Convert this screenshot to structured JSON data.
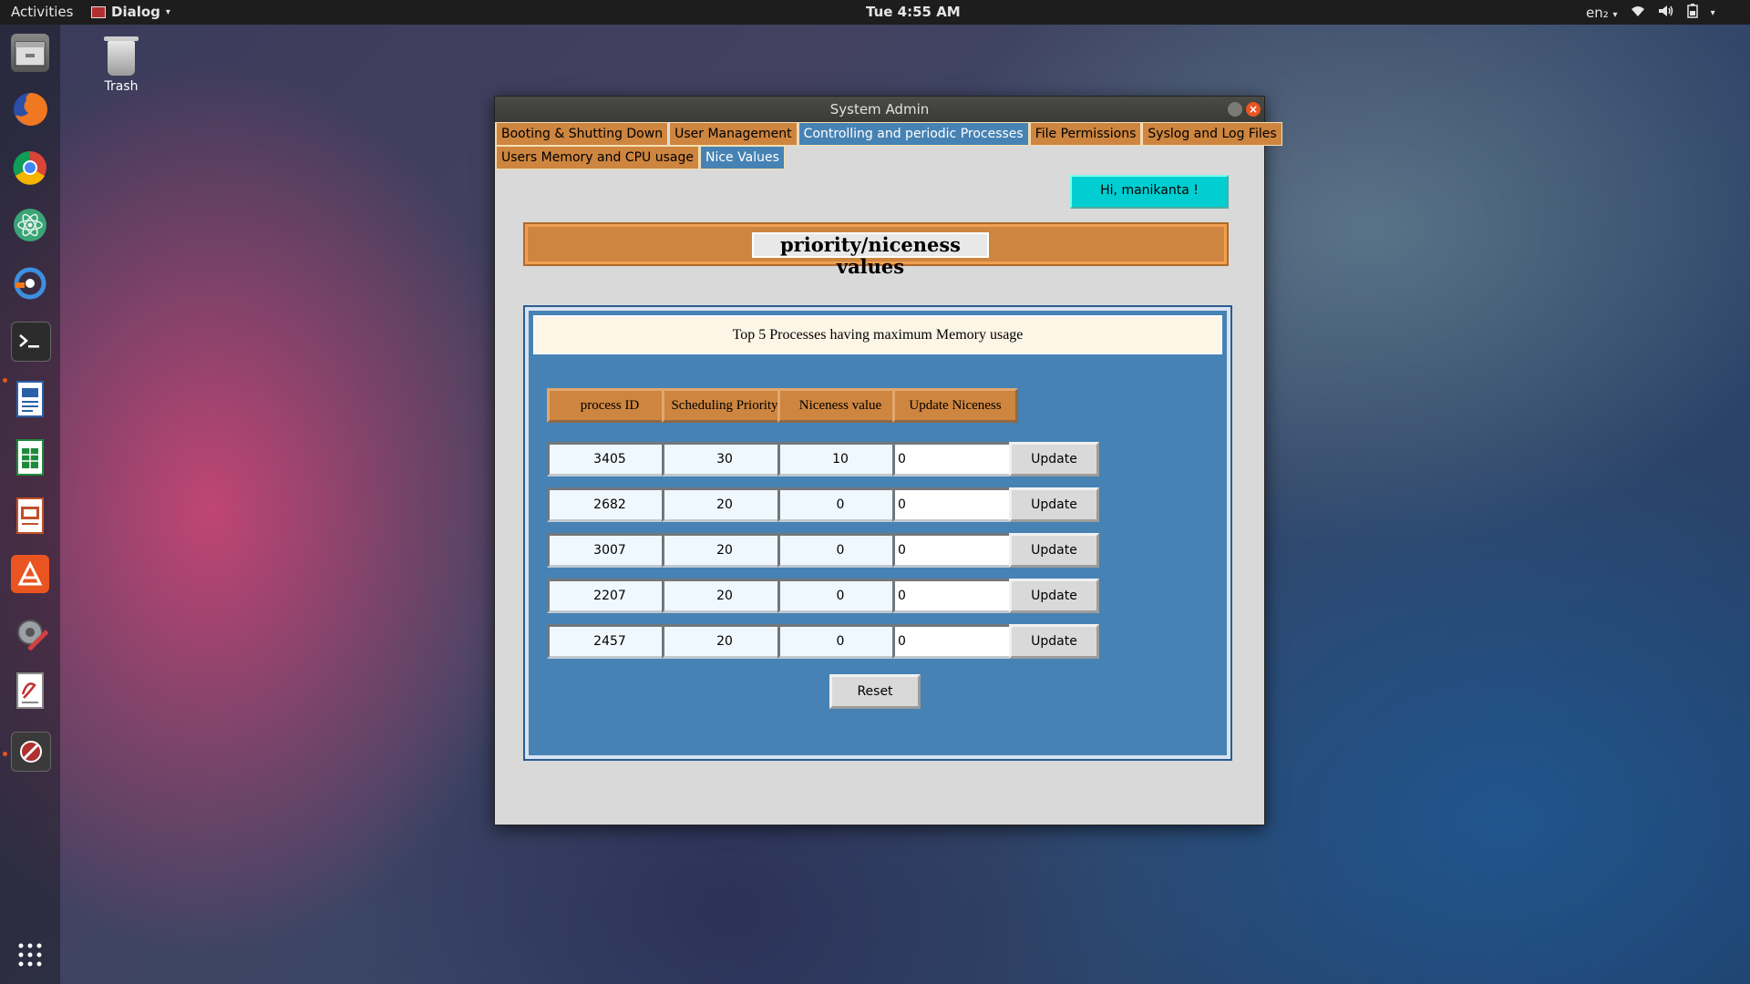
{
  "topbar": {
    "activities": "Activities",
    "app_menu": "Dialog",
    "clock": "Tue  4:55 AM",
    "lang": "en₂"
  },
  "desktop": {
    "trash_label": "Trash"
  },
  "dock": {
    "items": [
      "files-icon",
      "firefox-icon",
      "chrome-icon",
      "atom-icon",
      "blender-icon",
      "terminal-icon",
      "writer-icon",
      "calc-icon",
      "impress-icon",
      "software-center-icon",
      "settings-icon",
      "text-editor-icon",
      "blocked-app-icon",
      "app-grid-icon"
    ]
  },
  "window": {
    "title": "System Admin",
    "tabs_row1": [
      "Booting & Shutting Down",
      "User Management",
      "Controlling and periodic Processes",
      "File Permissions",
      "Syslog and Log Files"
    ],
    "tabs_row2": [
      "Users Memory and CPU usage",
      "Nice Values"
    ],
    "active_tabs": [
      "Controlling and periodic Processes",
      "Nice Values"
    ],
    "greeting": "Hi, manikanta !",
    "header_title": "priority/niceness values",
    "panel_caption": "Top 5 Processes having maximum Memory usage",
    "columns": [
      "process ID",
      "Scheduling Priority",
      "Niceness value",
      "Update Niceness"
    ],
    "rows": [
      {
        "pid": "3405",
        "priority": "30",
        "nice": "10",
        "update": "0"
      },
      {
        "pid": "2682",
        "priority": "20",
        "nice": "0",
        "update": "0"
      },
      {
        "pid": "3007",
        "priority": "20",
        "nice": "0",
        "update": "0"
      },
      {
        "pid": "2207",
        "priority": "20",
        "nice": "0",
        "update": "0"
      },
      {
        "pid": "2457",
        "priority": "20",
        "nice": "0",
        "update": "0"
      }
    ],
    "update_label": "Update",
    "reset_label": "Reset"
  },
  "colors": {
    "tab": "#cd853f",
    "tab_active": "#4682b4",
    "greeting_bg": "#00ced1",
    "panel_bg": "#4682b4",
    "caption_bg": "#fdf5e6"
  }
}
